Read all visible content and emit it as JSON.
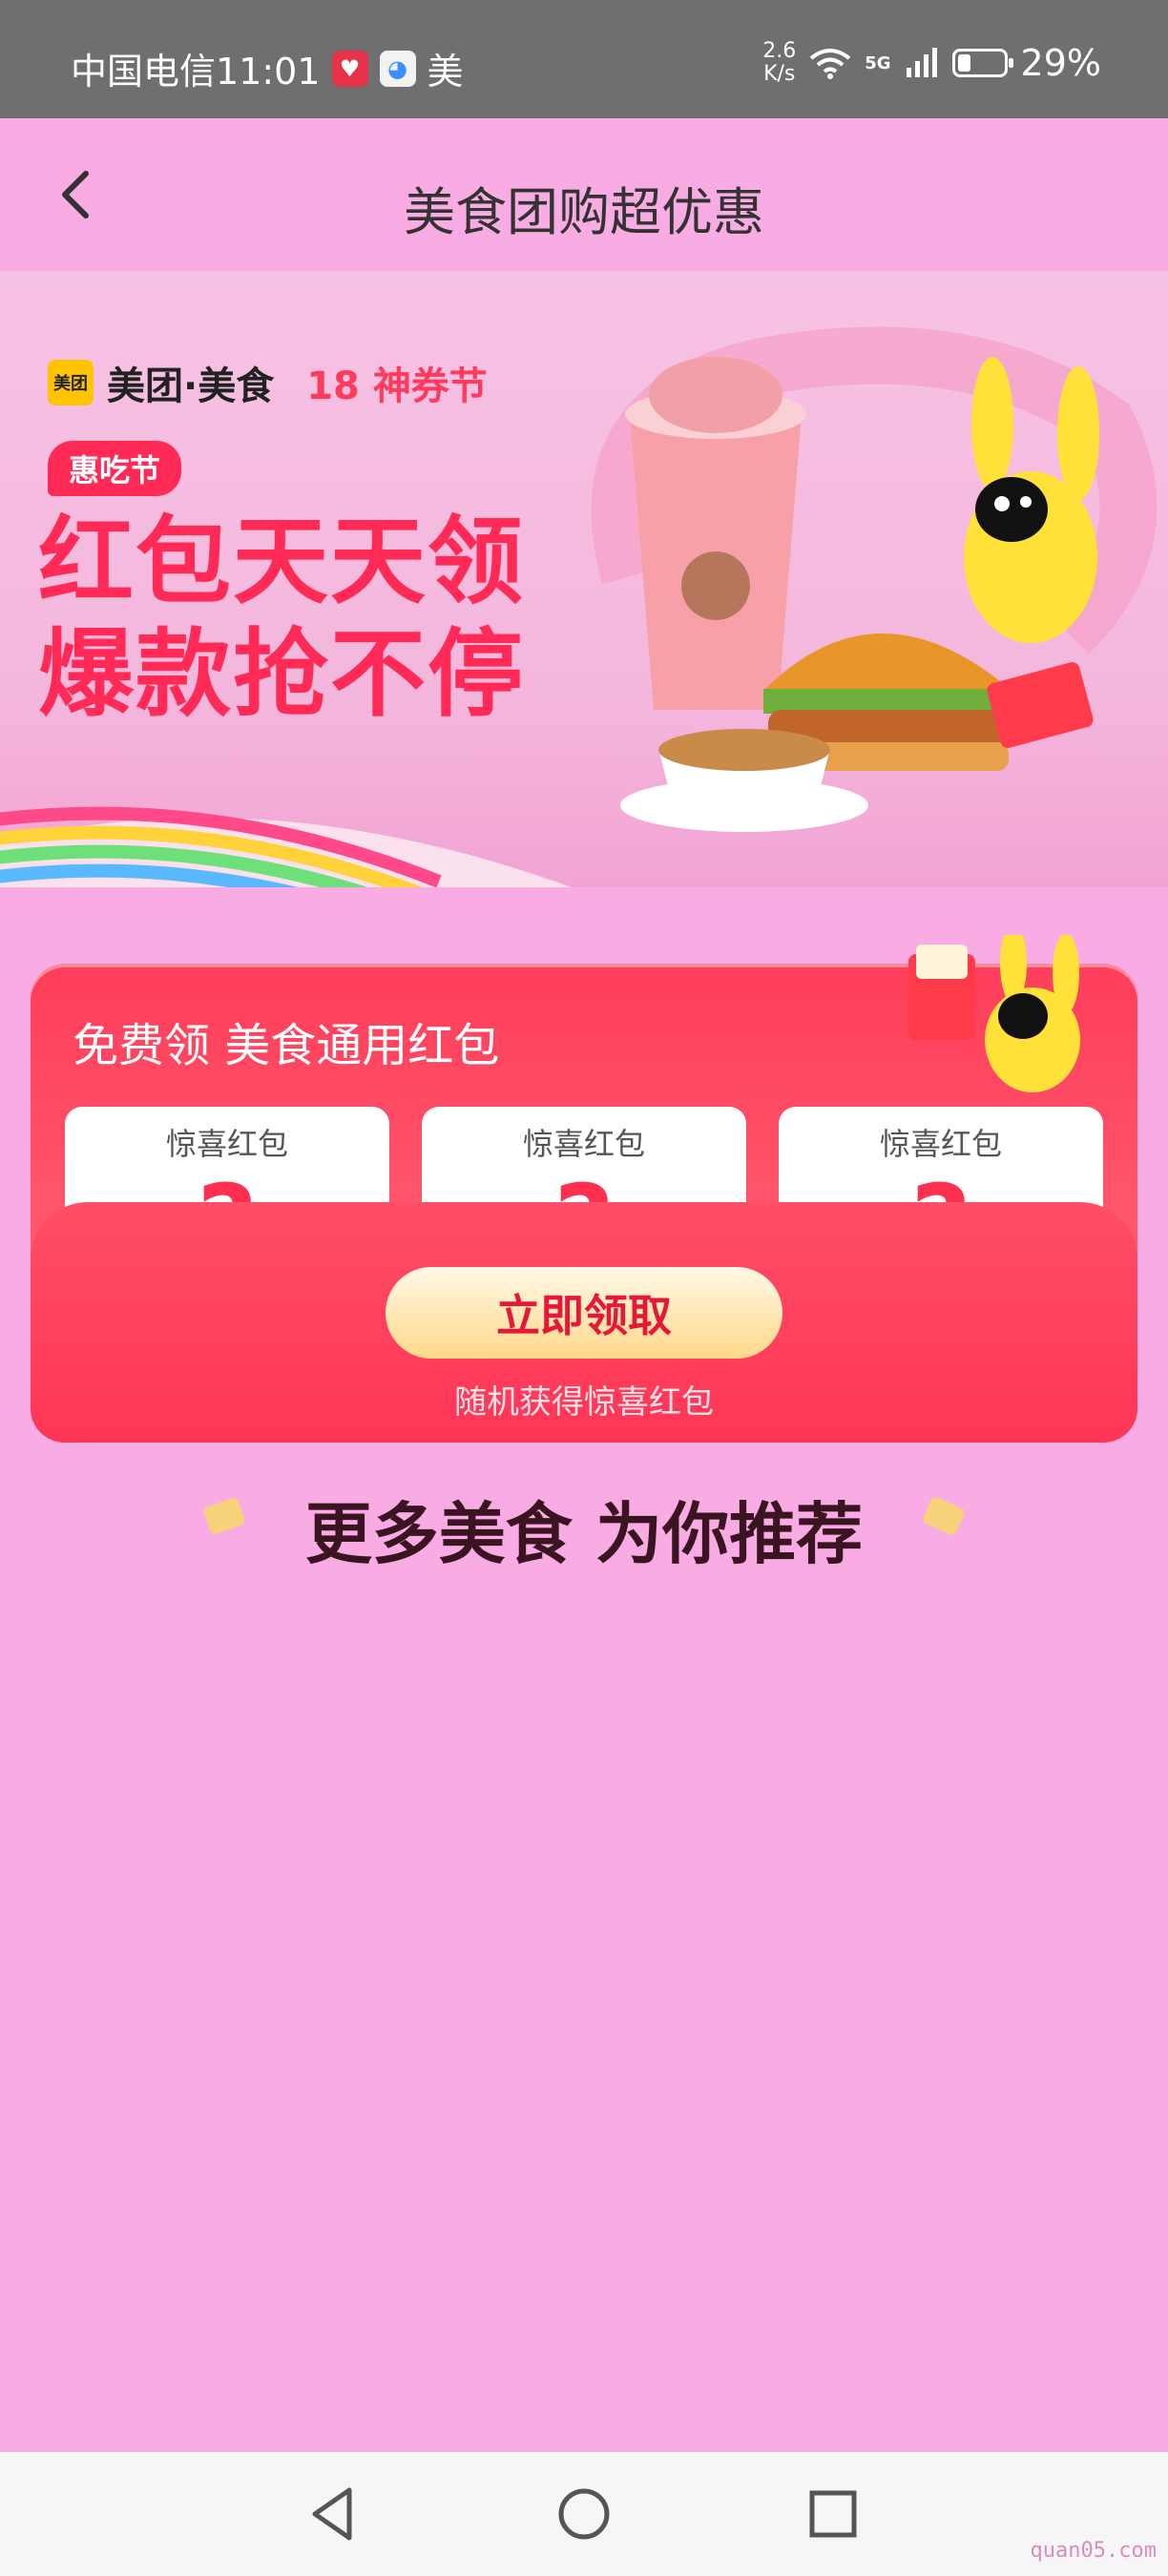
{
  "status_bar": {
    "carrier_time": "中国电信11:01",
    "notif_app_label": "美",
    "net_speed_value": "2.6",
    "net_speed_unit": "K/s",
    "network_type": "5G",
    "battery_percent": "29%",
    "battery_level": 0.29
  },
  "header": {
    "title": "美食团购超优惠",
    "back_icon": "chevron-left-icon"
  },
  "banner": {
    "logo_text": "美团",
    "brand": "美团·美食",
    "festival": "神券节",
    "tag": "惠吃节",
    "headline_line1": "红包天天领",
    "headline_line2": "爆款抢不停"
  },
  "coupon_card": {
    "title": "免费领 美食通用红包",
    "coupons": [
      {
        "title": "惊喜红包",
        "mark": "?"
      },
      {
        "title": "惊喜红包",
        "mark": "?"
      },
      {
        "title": "惊喜红包",
        "mark": "?"
      }
    ],
    "claim_button": "立即领取",
    "claim_subtitle": "随机获得惊喜红包"
  },
  "recommend": {
    "title": "更多美食 为你推荐"
  },
  "nav_bar": {
    "back": "triangle-back-icon",
    "home": "circle-home-icon",
    "recents": "square-recents-icon"
  },
  "watermark": "quan05.com",
  "colors": {
    "page_bg": "#f9abe3",
    "accent_red": "#ff2a55",
    "status_bar_bg": "#6f6f6f"
  }
}
